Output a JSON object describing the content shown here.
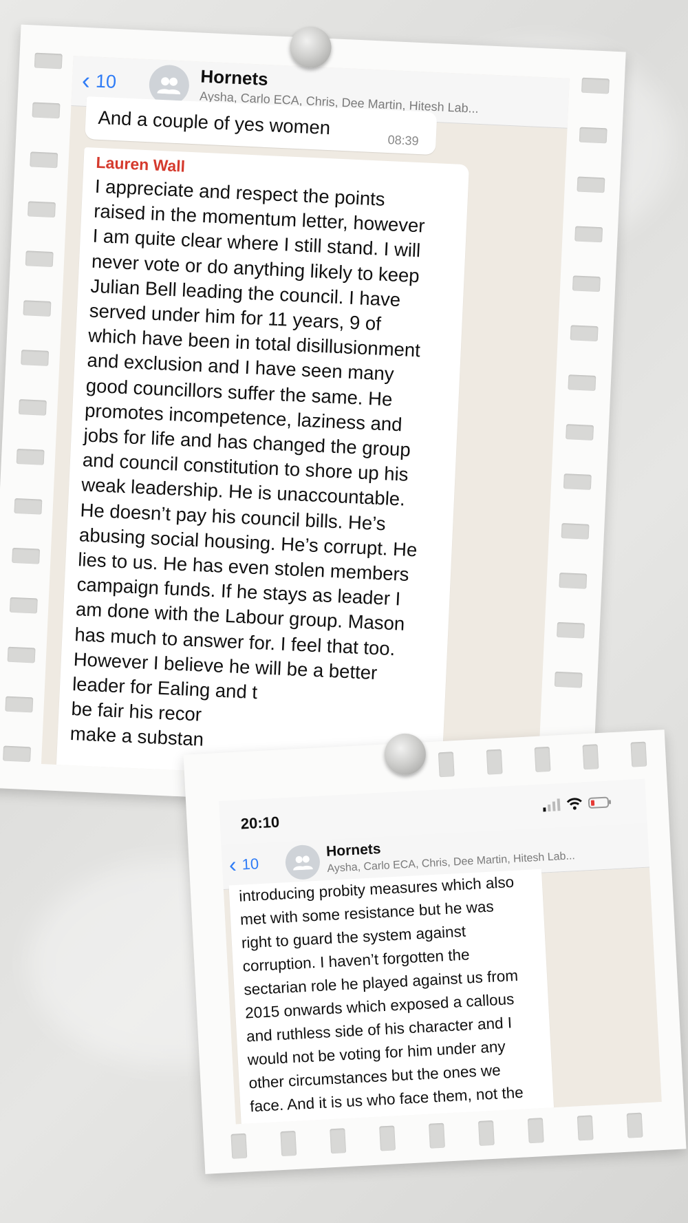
{
  "photo1": {
    "back_count": "10",
    "group_name": "Hornets",
    "group_members": "Aysha, Carlo ECA, Chris, Dee Martin, Hitesh Lab...",
    "prev_message": {
      "text": "And a couple of yes women",
      "time": "08:39"
    },
    "message": {
      "sender": "Lauren Wall",
      "lines": [
        "I appreciate and respect the points",
        "raised in the momentum letter, however",
        "I am quite clear where I still stand. I will",
        "never vote or do anything likely to keep",
        "Julian Bell leading the council. I have",
        "served under him for 11 years, 9 of",
        "which have been in total disillusionment",
        "and exclusion and I have seen many",
        "good councillors suffer the same. He",
        "promotes incompetence, laziness and",
        "jobs for life and has changed the group",
        "and council constitution to shore up his",
        "weak leadership. He is unaccountable.",
        "He doesn’t pay his council bills. He’s",
        "abusing social housing. He’s corrupt. He",
        "lies to us. He has even stolen members",
        "campaign funds. If he stays as leader I",
        "am done with the Labour group. Mason",
        "has much to answer for. I feel that too.",
        "However I believe he will be a better",
        "leader for Ealing and t",
        "be fair his recor",
        "make a substan"
      ]
    }
  },
  "photo2": {
    "status_time": "20:10",
    "back_count": "10",
    "group_name": "Hornets",
    "group_members": "Aysha, Carlo ECA, Chris, Dee Martin, Hitesh Lab...",
    "message": {
      "lines": [
        "introducing probity measures which also",
        "met with some resistance but he was",
        "right to guard the system against",
        "corruption. I haven’t forgotten the",
        "sectarian role he played against us from",
        "2015 onwards which exposed a callous",
        "and ruthless side of his character and I",
        "would not be voting for him under any",
        "other circumstances but the ones we",
        "face. And it is us who face them, not the"
      ]
    }
  },
  "colors": {
    "link_blue": "#2f7cf6",
    "sender_red": "#d53a2d",
    "chat_bg": "#efeae2",
    "battery_red": "#e53935"
  },
  "icons": {
    "back": "chevron-left-icon",
    "avatar": "group-avatar-icon",
    "signal": "signal-bars-icon",
    "wifi": "wifi-icon",
    "battery": "battery-low-icon"
  }
}
